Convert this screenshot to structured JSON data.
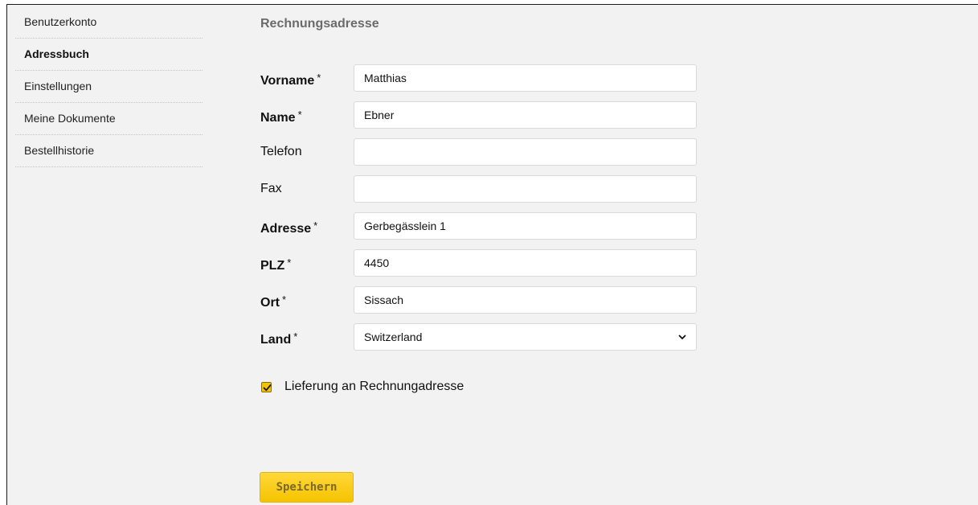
{
  "sidebar": {
    "items": [
      {
        "label": "Benutzerkonto",
        "active": false
      },
      {
        "label": "Adressbuch",
        "active": true
      },
      {
        "label": "Einstellungen",
        "active": false
      },
      {
        "label": "Meine Dokumente",
        "active": false
      },
      {
        "label": "Bestellhistorie",
        "active": false
      }
    ]
  },
  "form": {
    "title": "Rechnungsadresse",
    "required_marker": "*",
    "fields": {
      "vorname": {
        "label": "Vorname",
        "value": "Matthias"
      },
      "name": {
        "label": "Name",
        "value": "Ebner"
      },
      "telefon": {
        "label": "Telefon",
        "value": ""
      },
      "fax": {
        "label": "Fax",
        "value": ""
      },
      "adresse": {
        "label": "Adresse",
        "value": "Gerbegässlein 1"
      },
      "plz": {
        "label": "PLZ",
        "value": "4450"
      },
      "ort": {
        "label": "Ort",
        "value": "Sissach"
      },
      "land": {
        "label": "Land",
        "value": "Switzerland",
        "icon": "chevron-down-icon"
      }
    },
    "delivery_checkbox": {
      "label": "Lieferung an Rechnungadresse",
      "checked": true
    },
    "save_label": "Speichern"
  },
  "colors": {
    "accent": "#f5c400",
    "background": "#f2f2f2",
    "title_gray": "#6b6b6b"
  }
}
